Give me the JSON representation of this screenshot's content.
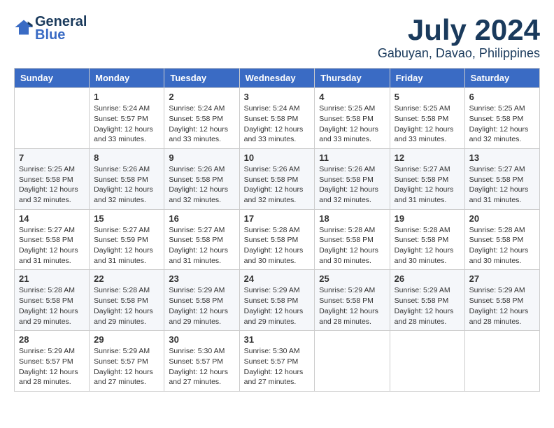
{
  "logo": {
    "line1": "General",
    "line2": "Blue"
  },
  "title": "July 2024",
  "location": "Gabuyan, Davao, Philippines",
  "days_of_week": [
    "Sunday",
    "Monday",
    "Tuesday",
    "Wednesday",
    "Thursday",
    "Friday",
    "Saturday"
  ],
  "weeks": [
    [
      {
        "day": "",
        "info": ""
      },
      {
        "day": "1",
        "info": "Sunrise: 5:24 AM\nSunset: 5:57 PM\nDaylight: 12 hours\nand 33 minutes."
      },
      {
        "day": "2",
        "info": "Sunrise: 5:24 AM\nSunset: 5:58 PM\nDaylight: 12 hours\nand 33 minutes."
      },
      {
        "day": "3",
        "info": "Sunrise: 5:24 AM\nSunset: 5:58 PM\nDaylight: 12 hours\nand 33 minutes."
      },
      {
        "day": "4",
        "info": "Sunrise: 5:25 AM\nSunset: 5:58 PM\nDaylight: 12 hours\nand 33 minutes."
      },
      {
        "day": "5",
        "info": "Sunrise: 5:25 AM\nSunset: 5:58 PM\nDaylight: 12 hours\nand 33 minutes."
      },
      {
        "day": "6",
        "info": "Sunrise: 5:25 AM\nSunset: 5:58 PM\nDaylight: 12 hours\nand 32 minutes."
      }
    ],
    [
      {
        "day": "7",
        "info": "Sunrise: 5:25 AM\nSunset: 5:58 PM\nDaylight: 12 hours\nand 32 minutes."
      },
      {
        "day": "8",
        "info": "Sunrise: 5:26 AM\nSunset: 5:58 PM\nDaylight: 12 hours\nand 32 minutes."
      },
      {
        "day": "9",
        "info": "Sunrise: 5:26 AM\nSunset: 5:58 PM\nDaylight: 12 hours\nand 32 minutes."
      },
      {
        "day": "10",
        "info": "Sunrise: 5:26 AM\nSunset: 5:58 PM\nDaylight: 12 hours\nand 32 minutes."
      },
      {
        "day": "11",
        "info": "Sunrise: 5:26 AM\nSunset: 5:58 PM\nDaylight: 12 hours\nand 32 minutes."
      },
      {
        "day": "12",
        "info": "Sunrise: 5:27 AM\nSunset: 5:58 PM\nDaylight: 12 hours\nand 31 minutes."
      },
      {
        "day": "13",
        "info": "Sunrise: 5:27 AM\nSunset: 5:58 PM\nDaylight: 12 hours\nand 31 minutes."
      }
    ],
    [
      {
        "day": "14",
        "info": "Sunrise: 5:27 AM\nSunset: 5:58 PM\nDaylight: 12 hours\nand 31 minutes."
      },
      {
        "day": "15",
        "info": "Sunrise: 5:27 AM\nSunset: 5:59 PM\nDaylight: 12 hours\nand 31 minutes."
      },
      {
        "day": "16",
        "info": "Sunrise: 5:27 AM\nSunset: 5:58 PM\nDaylight: 12 hours\nand 31 minutes."
      },
      {
        "day": "17",
        "info": "Sunrise: 5:28 AM\nSunset: 5:58 PM\nDaylight: 12 hours\nand 30 minutes."
      },
      {
        "day": "18",
        "info": "Sunrise: 5:28 AM\nSunset: 5:58 PM\nDaylight: 12 hours\nand 30 minutes."
      },
      {
        "day": "19",
        "info": "Sunrise: 5:28 AM\nSunset: 5:58 PM\nDaylight: 12 hours\nand 30 minutes."
      },
      {
        "day": "20",
        "info": "Sunrise: 5:28 AM\nSunset: 5:58 PM\nDaylight: 12 hours\nand 30 minutes."
      }
    ],
    [
      {
        "day": "21",
        "info": "Sunrise: 5:28 AM\nSunset: 5:58 PM\nDaylight: 12 hours\nand 29 minutes."
      },
      {
        "day": "22",
        "info": "Sunrise: 5:28 AM\nSunset: 5:58 PM\nDaylight: 12 hours\nand 29 minutes."
      },
      {
        "day": "23",
        "info": "Sunrise: 5:29 AM\nSunset: 5:58 PM\nDaylight: 12 hours\nand 29 minutes."
      },
      {
        "day": "24",
        "info": "Sunrise: 5:29 AM\nSunset: 5:58 PM\nDaylight: 12 hours\nand 29 minutes."
      },
      {
        "day": "25",
        "info": "Sunrise: 5:29 AM\nSunset: 5:58 PM\nDaylight: 12 hours\nand 28 minutes."
      },
      {
        "day": "26",
        "info": "Sunrise: 5:29 AM\nSunset: 5:58 PM\nDaylight: 12 hours\nand 28 minutes."
      },
      {
        "day": "27",
        "info": "Sunrise: 5:29 AM\nSunset: 5:58 PM\nDaylight: 12 hours\nand 28 minutes."
      }
    ],
    [
      {
        "day": "28",
        "info": "Sunrise: 5:29 AM\nSunset: 5:57 PM\nDaylight: 12 hours\nand 28 minutes."
      },
      {
        "day": "29",
        "info": "Sunrise: 5:29 AM\nSunset: 5:57 PM\nDaylight: 12 hours\nand 27 minutes."
      },
      {
        "day": "30",
        "info": "Sunrise: 5:30 AM\nSunset: 5:57 PM\nDaylight: 12 hours\nand 27 minutes."
      },
      {
        "day": "31",
        "info": "Sunrise: 5:30 AM\nSunset: 5:57 PM\nDaylight: 12 hours\nand 27 minutes."
      },
      {
        "day": "",
        "info": ""
      },
      {
        "day": "",
        "info": ""
      },
      {
        "day": "",
        "info": ""
      }
    ]
  ]
}
